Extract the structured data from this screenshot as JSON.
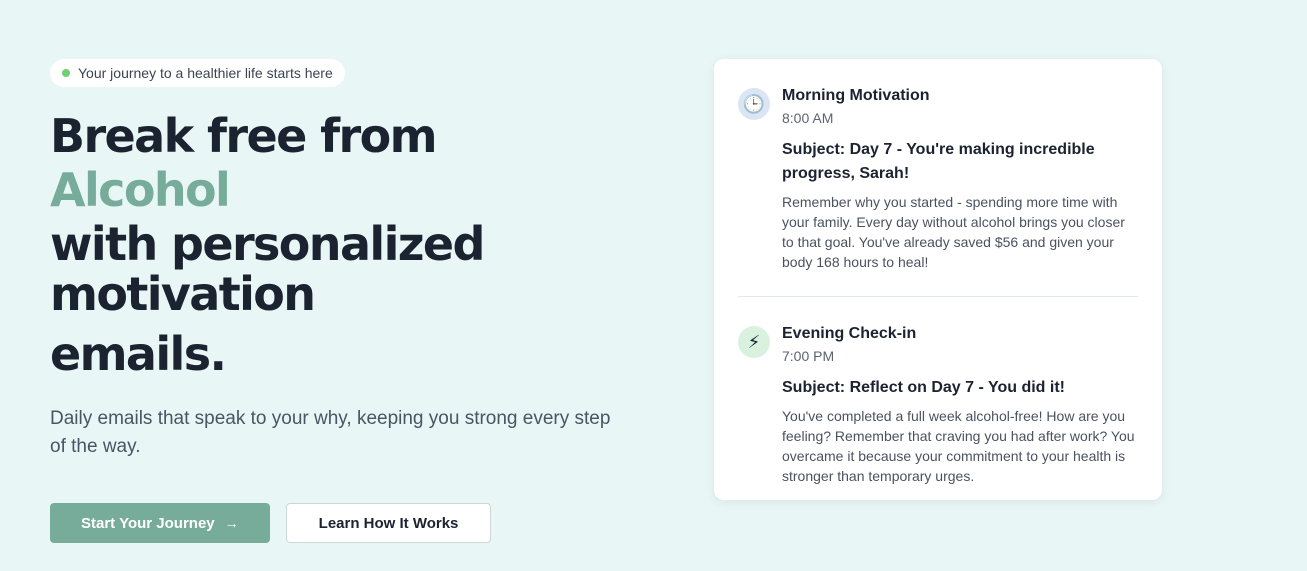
{
  "hero": {
    "badge": "Your journey to a healthier life starts here",
    "headline": {
      "line1": "Break free from",
      "accent": "Alcohol",
      "line3": "with personalized",
      "line4": "motivation",
      "line5": "emails."
    },
    "subtitle": "Daily emails that speak to your why, keeping you strong every step of the way.",
    "primary_button": "Start Your Journey",
    "primary_button_arrow": "→",
    "secondary_button": "Learn How It Works"
  },
  "emails": [
    {
      "icon": "clock-icon",
      "icon_glyph": "🕒",
      "title": "Morning Motivation",
      "time": "8:00 AM",
      "subject": "Subject: Day 7 - You're making incredible progress, Sarah!",
      "body": "Remember why you started - spending more time with your family. Every day without alcohol brings you closer to that goal. You've already saved $56 and given your body 168 hours to heal!"
    },
    {
      "icon": "lightning-icon",
      "icon_glyph": "⚡",
      "title": "Evening Check-in",
      "time": "7:00 PM",
      "subject": "Subject: Reflect on Day 7 - You did it!",
      "body": "You've completed a full week alcohol-free! How are you feeling? Remember that craving you had after work? You overcame it because your commitment to your health is stronger than temporary urges."
    }
  ],
  "colors": {
    "background": "#e9f6f6",
    "accent": "#78ac9a",
    "badge_dot": "#6fcf72",
    "text_dark": "#1b2230"
  }
}
